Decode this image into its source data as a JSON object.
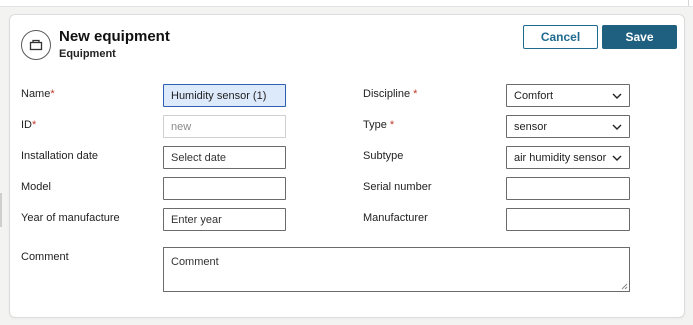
{
  "header": {
    "title": "New equipment",
    "subtitle": "Equipment",
    "icon": "equipment-icon"
  },
  "actions": {
    "cancel_label": "Cancel",
    "save_label": "Save",
    "save_color": "#1f5f80",
    "cancel_color": "#1f6a8f"
  },
  "fields": {
    "name": {
      "label": "Name",
      "required_mark": "*",
      "value": "Humidity sensor (1)"
    },
    "id": {
      "label": "ID",
      "required_mark": "*",
      "value": "new"
    },
    "installation_date": {
      "label": "Installation date",
      "placeholder": "Select date"
    },
    "model": {
      "label": "Model",
      "value": ""
    },
    "year_of_manufacture": {
      "label": "Year of manufacture",
      "placeholder": "Enter year"
    },
    "discipline": {
      "label": "Discipline ",
      "required_mark": "*",
      "value": "Comfort"
    },
    "type": {
      "label": "Type ",
      "required_mark": "*",
      "value": "sensor"
    },
    "subtype": {
      "label": "Subtype",
      "value": "air humidity sensor"
    },
    "serial_number": {
      "label": "Serial number",
      "value": ""
    },
    "manufacturer": {
      "label": "Manufacturer",
      "value": ""
    },
    "comment": {
      "label": "Comment",
      "placeholder": "Comment"
    }
  },
  "colors": {
    "required": "#c0392b",
    "focus_bg": "#ddeafc"
  }
}
